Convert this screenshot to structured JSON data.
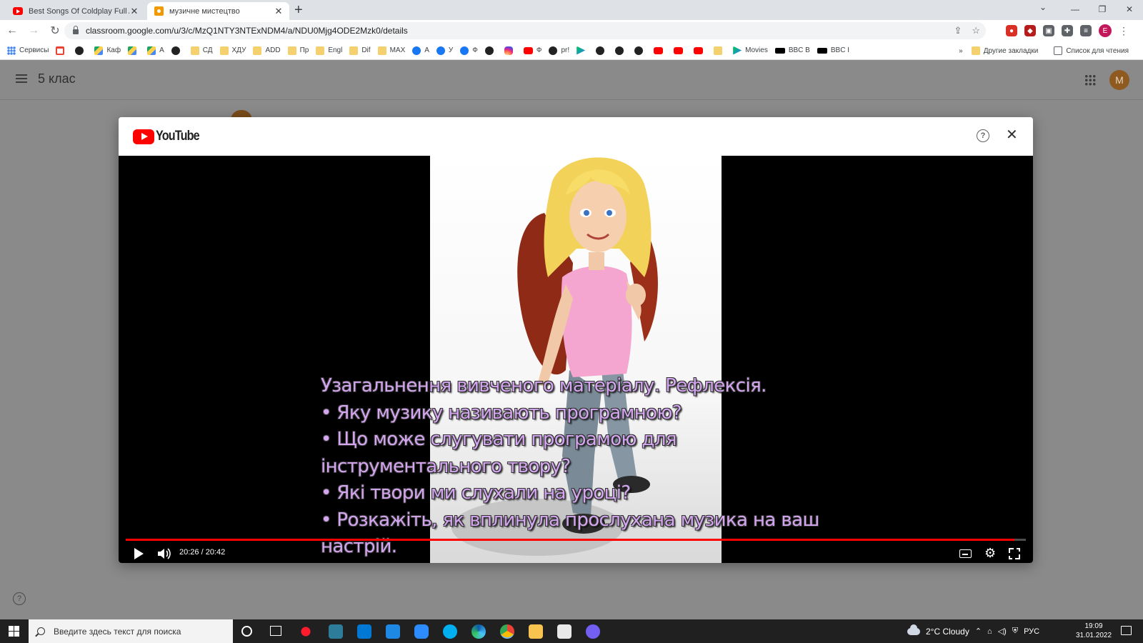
{
  "browser": {
    "tabs": [
      {
        "title": "Best Songs Of Coldplay Full Album",
        "favicon": "youtube-icon",
        "active": false
      },
      {
        "title": "музичне мистецтво",
        "favicon": "classroom-icon",
        "active": true
      }
    ],
    "url": "classroom.google.com/u/3/c/MzQ1NTY3NTExNDM4/a/NDU0Mjg4ODE2Mzk0/details",
    "profile_initial": "E",
    "bookmarks": [
      {
        "label": "Сервисы",
        "icon": "apps"
      },
      {
        "label": "",
        "icon": "gmail"
      },
      {
        "label": "",
        "icon": "dark"
      },
      {
        "label": "Каф",
        "icon": "drive"
      },
      {
        "label": "",
        "icon": "drive"
      },
      {
        "label": "A",
        "icon": "drive"
      },
      {
        "label": "",
        "icon": "dark"
      },
      {
        "label": "СД",
        "icon": "folder"
      },
      {
        "label": "ХДУ",
        "icon": "folder"
      },
      {
        "label": "ADD",
        "icon": "folder"
      },
      {
        "label": "Пр",
        "icon": "folder"
      },
      {
        "label": "Engl",
        "icon": "folder"
      },
      {
        "label": "Dif",
        "icon": "folder"
      },
      {
        "label": "MAX",
        "icon": "folder"
      },
      {
        "label": "A",
        "icon": "fb"
      },
      {
        "label": "У",
        "icon": "fb"
      },
      {
        "label": "Ф",
        "icon": "fb"
      },
      {
        "label": "",
        "icon": "dark"
      },
      {
        "label": "",
        "icon": "insta"
      },
      {
        "label": "Ф",
        "icon": "yt"
      },
      {
        "label": "pr!",
        "icon": "dark"
      },
      {
        "label": "",
        "icon": "play"
      },
      {
        "label": "",
        "icon": "dark"
      },
      {
        "label": "",
        "icon": "dark"
      },
      {
        "label": "",
        "icon": "dark"
      },
      {
        "label": "",
        "icon": "yt"
      },
      {
        "label": "",
        "icon": "yt"
      },
      {
        "label": "",
        "icon": "yt"
      },
      {
        "label": "",
        "icon": "folder"
      },
      {
        "label": "Movies",
        "icon": "play"
      },
      {
        "label": "BBC B",
        "icon": "bbc"
      },
      {
        "label": "BBC I",
        "icon": "bbc"
      }
    ],
    "overflow_label": "»",
    "other_bookmarks": "Другие закладки",
    "reading_list": "Список для чтения"
  },
  "classroom": {
    "title": "5 клас",
    "avatar_initial": "M",
    "help_glyph": "?"
  },
  "youtube": {
    "logo_text": "YouTube",
    "help_glyph": "?",
    "close_glyph": "✕",
    "subtitle_lines": [
      "Узагальнення вивченого матеріалу. Рефлексія.",
      "•  Яку музику називають програмною?",
      "•  Що може слугувати програмою для",
      "інструментального твору?",
      "• Які твори ми слухали на уроці?",
      "• Розкажіть, як вплинула прослухана музика на ваш",
      "настрій."
    ],
    "time": "20:26 / 20:42",
    "progress_fraction": 0.987,
    "gear_glyph": "⚙"
  },
  "taskbar": {
    "search_placeholder": "Введите здесь текст для поиска",
    "weather": "2°C  Cloudy",
    "lang": "РУС",
    "time": "19:09",
    "date": "31.01.2022"
  },
  "colors": {
    "subtitle": "#d4a6f0",
    "youtube_red": "#ff0000"
  }
}
